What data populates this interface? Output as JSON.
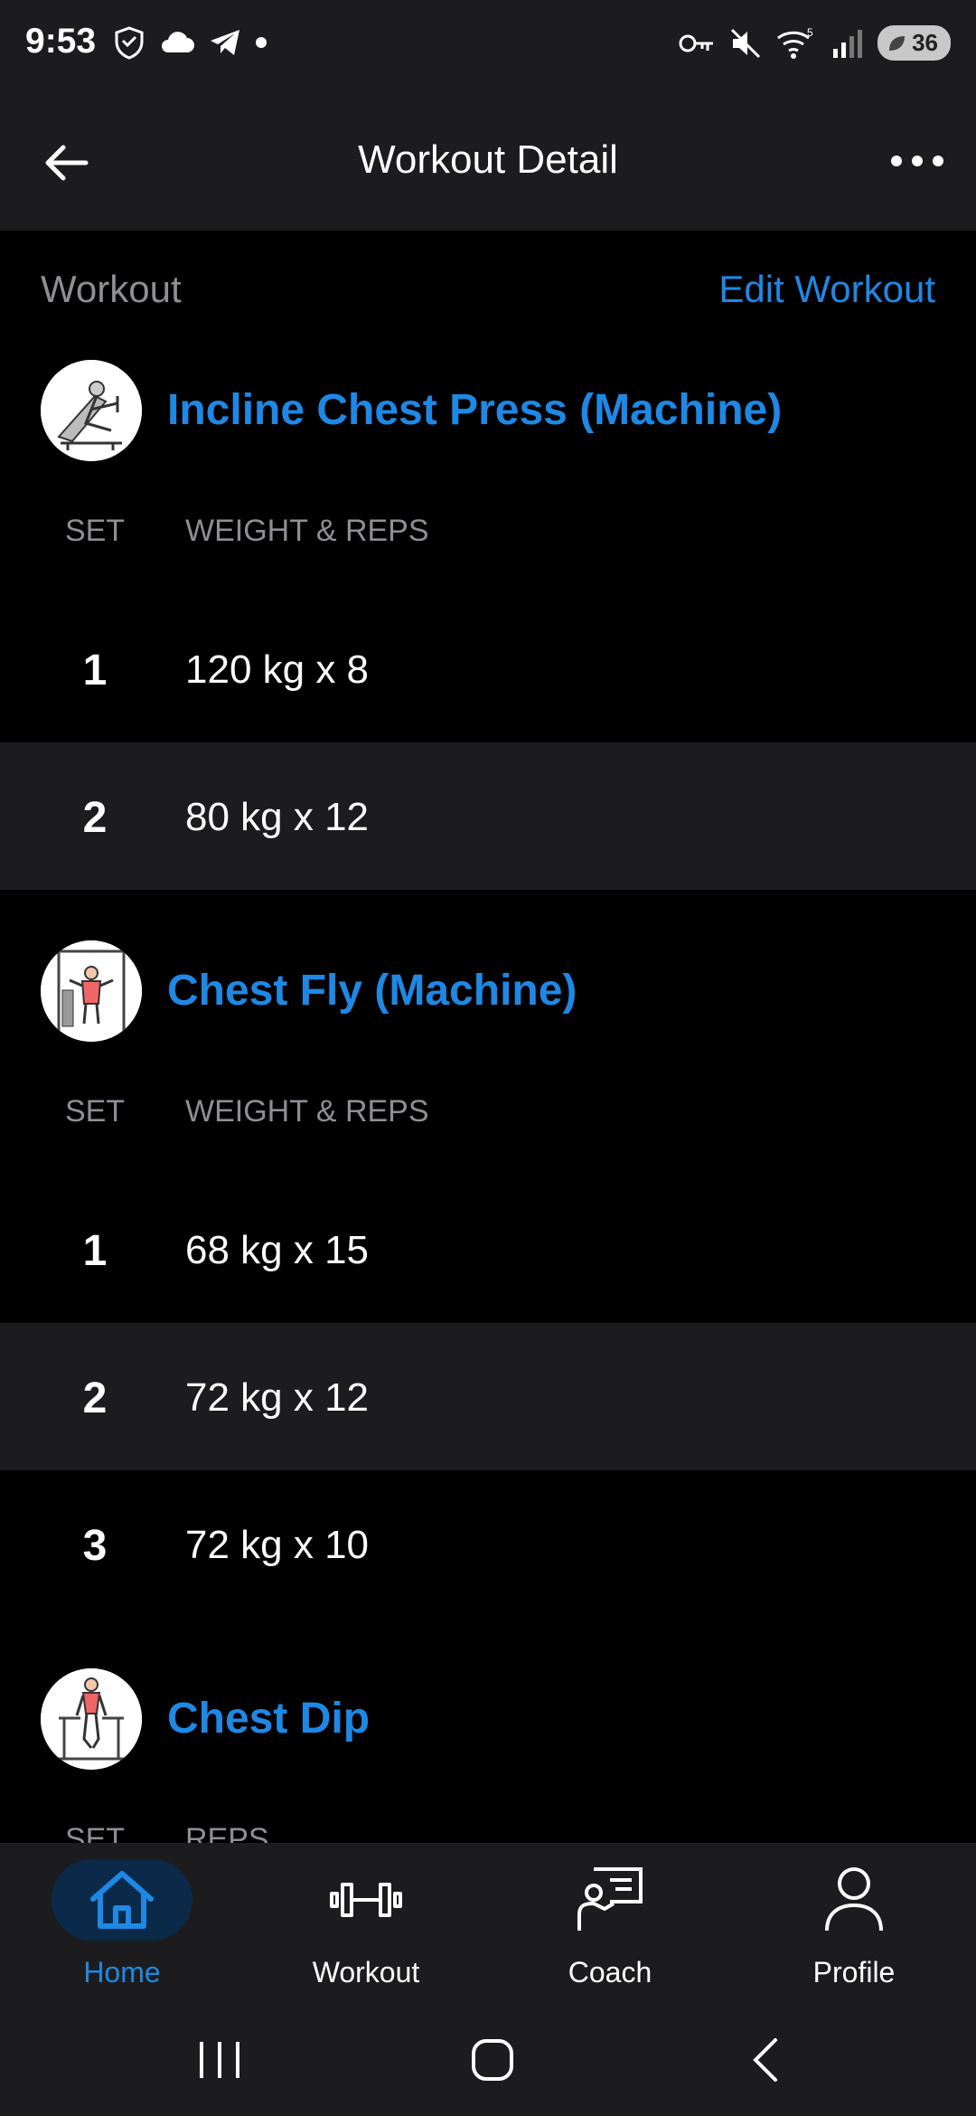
{
  "status": {
    "time": "9:53",
    "battery": "36"
  },
  "header": {
    "title": "Workout Detail"
  },
  "section": {
    "label": "Workout",
    "edit_label": "Edit Workout"
  },
  "columns": {
    "set": "SET",
    "weight_reps": "WEIGHT & REPS",
    "reps": "REPS"
  },
  "exercises": [
    {
      "name": "Incline Chest Press (Machine)",
      "sets": [
        {
          "set": "1",
          "value": "120 kg x 8"
        },
        {
          "set": "2",
          "value": "80 kg x 12"
        }
      ]
    },
    {
      "name": "Chest Fly (Machine)",
      "sets": [
        {
          "set": "1",
          "value": "68 kg x 15"
        },
        {
          "set": "2",
          "value": "72 kg x 12"
        },
        {
          "set": "3",
          "value": "72 kg x 10"
        }
      ]
    },
    {
      "name": "Chest Dip",
      "sets": []
    }
  ],
  "nav": {
    "items": [
      {
        "label": "Home",
        "icon": "home-icon",
        "active": true
      },
      {
        "label": "Workout",
        "icon": "dumbbell-icon",
        "active": false
      },
      {
        "label": "Coach",
        "icon": "coach-icon",
        "active": false
      },
      {
        "label": "Profile",
        "icon": "profile-icon",
        "active": false
      }
    ]
  },
  "colors": {
    "accent": "#1e88e5",
    "background": "#000000",
    "surface": "#1c1c1e",
    "muted": "#8e8e93"
  }
}
